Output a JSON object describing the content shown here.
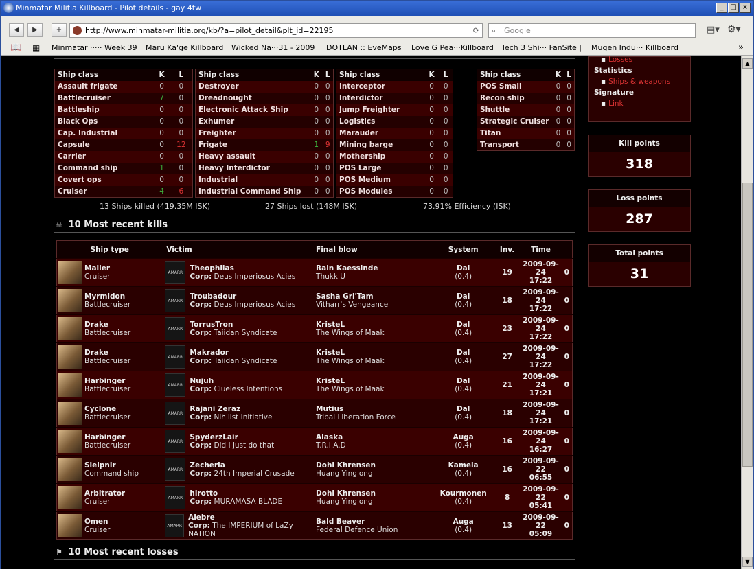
{
  "window": {
    "title": "Minmatar Militia Killboard - Pilot details - gay 4tw"
  },
  "browser": {
    "url": "http://www.minmatar-militia.org/kb/?a=pilot_detail&plt_id=22195",
    "search_placeholder": "Google"
  },
  "bookmarks": [
    "Minmatar ····· Week 39",
    "Maru Ka'ge Killboard",
    "Wicked Na···31 - 2009",
    "DOTLAN :: EveMaps",
    "Love G Pea···Killboard",
    "Tech 3 Shi··· FanSite |",
    "Mugen Indu··· Killboard"
  ],
  "menu": {
    "losses_link": "Losses",
    "statistics_label": "Statistics",
    "ships_weapons_link": "Ships & weapons",
    "signature_label": "Signature",
    "link_link": "Link"
  },
  "class_header": {
    "ship_class": "Ship class",
    "k": "K",
    "l": "L"
  },
  "class_tables": [
    [
      [
        "Assault frigate",
        "0",
        "0"
      ],
      [
        "Battlecruiser",
        "7",
        "0"
      ],
      [
        "Battleship",
        "0",
        "0"
      ],
      [
        "Black Ops",
        "0",
        "0"
      ],
      [
        "Cap. Industrial",
        "0",
        "0"
      ],
      [
        "Capsule",
        "0",
        "12"
      ],
      [
        "Carrier",
        "0",
        "0"
      ],
      [
        "Command ship",
        "1",
        "0"
      ],
      [
        "Covert ops",
        "0",
        "0"
      ],
      [
        "Cruiser",
        "4",
        "6"
      ]
    ],
    [
      [
        "Destroyer",
        "0",
        "0"
      ],
      [
        "Dreadnought",
        "0",
        "0"
      ],
      [
        "Electronic Attack Ship",
        "0",
        "0"
      ],
      [
        "Exhumer",
        "0",
        "0"
      ],
      [
        "Freighter",
        "0",
        "0"
      ],
      [
        "Frigate",
        "1",
        "9"
      ],
      [
        "Heavy assault",
        "0",
        "0"
      ],
      [
        "Heavy Interdictor",
        "0",
        "0"
      ],
      [
        "Industrial",
        "0",
        "0"
      ],
      [
        "Industrial Command Ship",
        "0",
        "0"
      ]
    ],
    [
      [
        "Interceptor",
        "0",
        "0"
      ],
      [
        "Interdictor",
        "0",
        "0"
      ],
      [
        "Jump Freighter",
        "0",
        "0"
      ],
      [
        "Logistics",
        "0",
        "0"
      ],
      [
        "Marauder",
        "0",
        "0"
      ],
      [
        "Mining barge",
        "0",
        "0"
      ],
      [
        "Mothership",
        "0",
        "0"
      ],
      [
        "POS Large",
        "0",
        "0"
      ],
      [
        "POS Medium",
        "0",
        "0"
      ],
      [
        "POS Modules",
        "0",
        "0"
      ]
    ],
    [
      [
        "POS Small",
        "0",
        "0"
      ],
      [
        "Recon ship",
        "0",
        "0"
      ],
      [
        "Shuttle",
        "0",
        "0"
      ],
      [
        "Strategic Cruiser",
        "0",
        "0"
      ],
      [
        "Titan",
        "0",
        "0"
      ],
      [
        "Transport",
        "0",
        "0"
      ]
    ]
  ],
  "summary": {
    "killed": "13 Ships killed (419.35M ISK)",
    "lost": "27 Ships lost (148M ISK)",
    "efficiency": "73.91% Efficiency (ISK)"
  },
  "kills_section": {
    "title": "10 Most recent kills",
    "headers": [
      "Ship type",
      "Victim",
      "Final blow",
      "System",
      "Inv.",
      "Time"
    ]
  },
  "kills": [
    {
      "ship": "Maller",
      "cls": "Cruiser",
      "victim": "Theophilas",
      "corp": "Deus Imperiosus Acies",
      "fb": "Rain Kaessinde",
      "fbcorp": "Thukk U",
      "sys": "Dal",
      "sec": "(0.4)",
      "inv": "19",
      "date": "2009-09-24",
      "time": "17:22",
      "pts": "0"
    },
    {
      "ship": "Myrmidon",
      "cls": "Battlecruiser",
      "victim": "Troubadour",
      "corp": "Deus Imperiosus Acies",
      "fb": "Sasha Gri'Tam",
      "fbcorp": "Vitharr's Vengeance",
      "sys": "Dal",
      "sec": "(0.4)",
      "inv": "18",
      "date": "2009-09-24",
      "time": "17:22",
      "pts": "0"
    },
    {
      "ship": "Drake",
      "cls": "Battlecruiser",
      "victim": "TorrusTron",
      "corp": "Taiidan Syndicate",
      "fb": "KristeL",
      "fbcorp": "The Wings of Maak",
      "sys": "Dal",
      "sec": "(0.4)",
      "inv": "23",
      "date": "2009-09-24",
      "time": "17:22",
      "pts": "0"
    },
    {
      "ship": "Drake",
      "cls": "Battlecruiser",
      "victim": "Makrador",
      "corp": "Taiidan Syndicate",
      "fb": "KristeL",
      "fbcorp": "The Wings of Maak",
      "sys": "Dal",
      "sec": "(0.4)",
      "inv": "27",
      "date": "2009-09-24",
      "time": "17:22",
      "pts": "0"
    },
    {
      "ship": "Harbinger",
      "cls": "Battlecruiser",
      "victim": "Nujuh",
      "corp": "Clueless Intentions",
      "fb": "KristeL",
      "fbcorp": "The Wings of Maak",
      "sys": "Dal",
      "sec": "(0.4)",
      "inv": "21",
      "date": "2009-09-24",
      "time": "17:21",
      "pts": "0"
    },
    {
      "ship": "Cyclone",
      "cls": "Battlecruiser",
      "victim": "Rajani Zeraz",
      "corp": "Nihilist Initiative",
      "fb": "Mutius",
      "fbcorp": "Tribal Liberation Force",
      "sys": "Dal",
      "sec": "(0.4)",
      "inv": "18",
      "date": "2009-09-24",
      "time": "17:21",
      "pts": "0"
    },
    {
      "ship": "Harbinger",
      "cls": "Battlecruiser",
      "victim": "SpyderzLair",
      "corp": "Did I just do that",
      "fb": "Alaska",
      "fbcorp": "T.R.I.A.D",
      "sys": "Auga",
      "sec": "(0.4)",
      "inv": "16",
      "date": "2009-09-24",
      "time": "16:27",
      "pts": "0"
    },
    {
      "ship": "Sleipnir",
      "cls": "Command ship",
      "victim": "Zecheria",
      "corp": "24th Imperial Crusade",
      "fb": "Dohl Khrensen",
      "fbcorp": "Huang Yinglong",
      "sys": "Kamela",
      "sec": "(0.4)",
      "inv": "16",
      "date": "2009-09-22",
      "time": "06:55",
      "pts": "0"
    },
    {
      "ship": "Arbitrator",
      "cls": "Cruiser",
      "victim": "hirotto",
      "corp": "MURAMASA BLADE",
      "fb": "Dohl Khrensen",
      "fbcorp": "Huang Yinglong",
      "sys": "Kourmonen",
      "sec": "(0.4)",
      "inv": "8",
      "date": "2009-09-22",
      "time": "05:41",
      "pts": "0"
    },
    {
      "ship": "Omen",
      "cls": "Cruiser",
      "victim": "Alebre",
      "corp": "The IMPERIUM of LaZy NATION",
      "fb": "Bald Beaver",
      "fbcorp": "Federal Defence Union",
      "sys": "Auga",
      "sec": "(0.4)",
      "inv": "13",
      "date": "2009-09-22",
      "time": "05:09",
      "pts": "0"
    }
  ],
  "corp_logo_text": "AMARR",
  "corp_prefix": "Corp:",
  "losses_section": {
    "title": "10 Most recent losses"
  },
  "points": {
    "kill_label": "Kill points",
    "kill_value": "318",
    "loss_label": "Loss points",
    "loss_value": "287",
    "total_label": "Total points",
    "total_value": "31"
  }
}
